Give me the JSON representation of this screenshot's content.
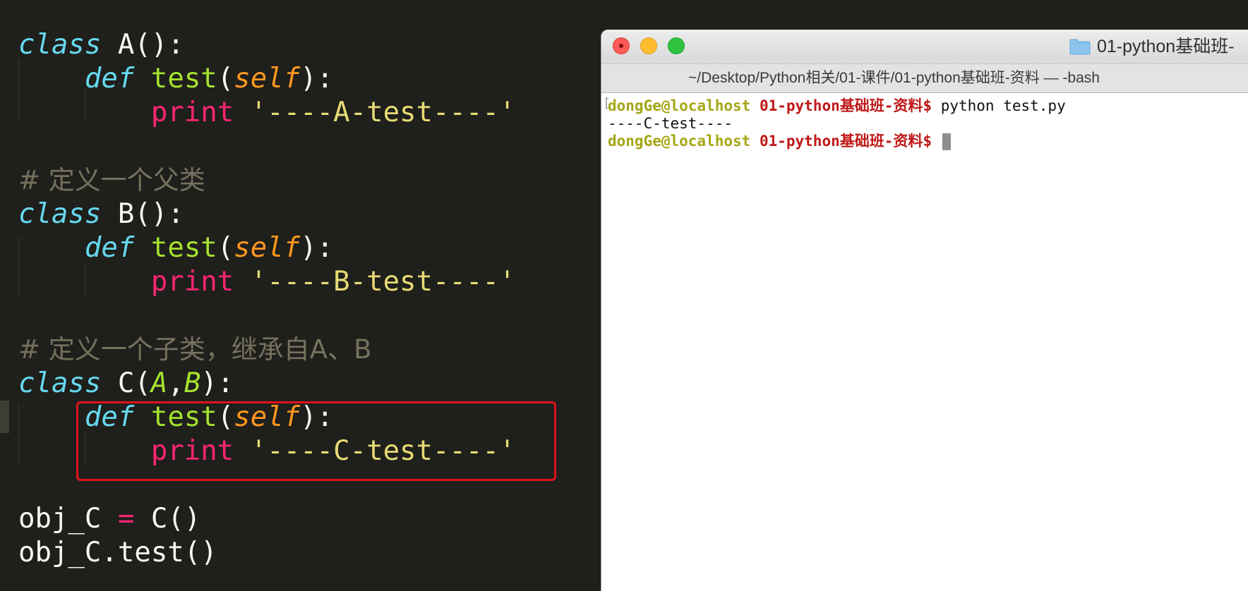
{
  "editor": {
    "lines": {
      "a_class_kw": "class",
      "a_class_rest": " A():",
      "a_def_kw": "def",
      "a_fn": "test",
      "a_paren_open": "(",
      "a_self": "self",
      "a_paren_close": "):",
      "a_print_kw": "print",
      "a_str": "'----A-test----'",
      "comment_parent": "# 定义一个父类",
      "b_class_kw": "class",
      "b_class_rest": " B():",
      "b_def_kw": "def",
      "b_fn": "test",
      "b_paren_open": "(",
      "b_self": "self",
      "b_paren_close": "):",
      "b_print_kw": "print",
      "b_str": "'----B-test----'",
      "comment_child": "# 定义一个子类，继承自A、B",
      "c_class_kw": "class",
      "c_class_name": " C(",
      "c_base_a": "A",
      "c_comma": ",",
      "c_base_b": "B",
      "c_class_close": "):",
      "c_def_kw": "def",
      "c_fn": "test",
      "c_paren_open": "(",
      "c_self": "self",
      "c_paren_close": "):",
      "c_print_kw": "print",
      "c_str": "'----C-test----'",
      "obj_left": "obj_C ",
      "obj_eq": "=",
      "obj_right": " C()",
      "call": "obj_C.test()"
    },
    "colors": {
      "background": "#1f1f1c",
      "keyword": "#66d9ef",
      "function": "#a6e22e",
      "parameter": "#fd971f",
      "print": "#f92672",
      "string": "#e6db74",
      "comment": "#75715e",
      "highlight_box": "#e1121c"
    }
  },
  "terminal": {
    "window_title": "01-python基础班-",
    "tab_title": "~/Desktop/Python相关/01-课件/01-python基础班-资料 — -bash",
    "prompt_user": "dongGe@localhost",
    "prompt_dir": "01-python基础班-资料",
    "prompt_symbol": "$",
    "command": "python test.py",
    "output": "----C-test----",
    "bracket": "[",
    "icons": {
      "close": "close-button",
      "minimize": "minimize-button",
      "zoom": "zoom-button",
      "folder": "folder-icon"
    }
  }
}
